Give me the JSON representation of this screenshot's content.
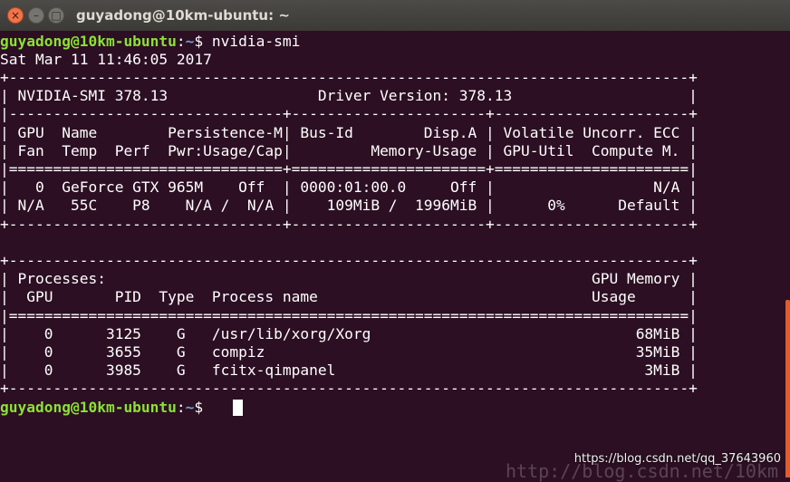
{
  "window": {
    "title": "guyadong@10km-ubuntu: ~",
    "close_glyph": "×",
    "minimize_glyph": "–",
    "maximize_glyph": "□"
  },
  "prompt": {
    "user_host": "guyadong@10km-ubuntu",
    "path": "~",
    "symbol": "$"
  },
  "command": "nvidia-smi",
  "date_line": "Sat Mar 11 11:46:05 2017",
  "smi_lines": [
    "+-----------------------------------------------------------------------------+",
    "| NVIDIA-SMI 378.13                 Driver Version: 378.13                    |",
    "|-------------------------------+----------------------+----------------------+",
    "| GPU  Name        Persistence-M| Bus-Id        Disp.A | Volatile Uncorr. ECC |",
    "| Fan  Temp  Perf  Pwr:Usage/Cap|         Memory-Usage | GPU-Util  Compute M. |",
    "|===============================+======================+======================|",
    "|   0  GeForce GTX 965M    Off  | 0000:01:00.0     Off |                  N/A |",
    "| N/A   55C    P8    N/A /  N/A |    109MiB /  1996MiB |      0%      Default |",
    "+-------------------------------+----------------------+----------------------+",
    "",
    "+-----------------------------------------------------------------------------+",
    "| Processes:                                                       GPU Memory |",
    "|  GPU       PID  Type  Process name                               Usage      |",
    "|=============================================================================|",
    "|    0      3125    G   /usr/lib/xorg/Xorg                              68MiB |",
    "|    0      3655    G   compiz                                          35MiB |",
    "|    0      3985    G   fcitx-qimpanel                                   3MiB |",
    "+-----------------------------------------------------------------------------+"
  ],
  "watermark": "https://blog.csdn.net/qq_37643960",
  "watermark_faded": "http://blog.csdn.net/10km",
  "colors": {
    "background": "#2c0f23",
    "prompt_user": "#8ae234",
    "prompt_path": "#729fcf",
    "scrollbar": "#e35c2a"
  }
}
